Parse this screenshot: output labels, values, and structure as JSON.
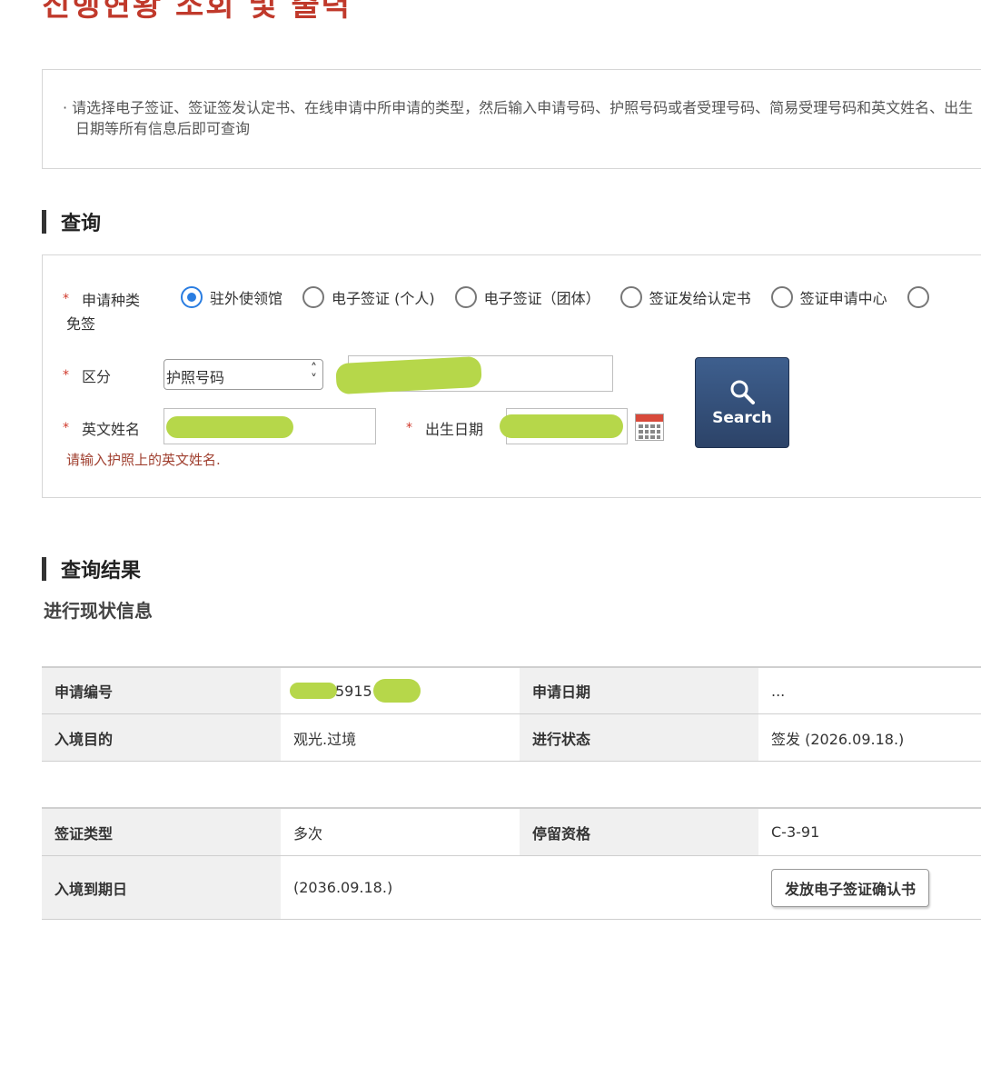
{
  "page": {
    "title": "진행현황 조회 및 출력"
  },
  "notice": {
    "text": "· 请选择电子签证、签证签发认定书、在线申请中所申请的类型，然后输入申请号码、护照号码或者受理号码、简易受理号码和英文姓名、出生日期等所有信息后即可查询"
  },
  "query_section": {
    "title": "查询"
  },
  "form": {
    "required_mark": "*",
    "app_type_label": "申请种类",
    "app_types": [
      {
        "label": "驻外使领馆",
        "selected": true
      },
      {
        "label": "电子签证 (个人)",
        "selected": false
      },
      {
        "label": "电子签证（团体）",
        "selected": false
      },
      {
        "label": "签证发给认定书",
        "selected": false
      },
      {
        "label": "签证申请中心",
        "selected": false
      },
      {
        "label": "免签",
        "selected": false
      }
    ],
    "category_label": "区分",
    "category_selected": "护照号码",
    "name_label": "英文姓名",
    "dob_label": "出生日期",
    "search_label": "Search",
    "hint": "请输入护照上的英文姓名."
  },
  "result_section": {
    "title": "查询结果",
    "subtitle": "进行现状信息"
  },
  "table1": {
    "rows": [
      {
        "k1": "申请编号",
        "v1": "5915",
        "k2": "申请日期",
        "v2": "..."
      },
      {
        "k1": "入境目的",
        "v1": "观光.过境",
        "k2": "进行状态",
        "v2": "签发 (2026.09.18.)"
      }
    ]
  },
  "table2": {
    "rows": [
      {
        "k1": "签证类型",
        "v1": "多次",
        "k2": "停留资格",
        "v2": "C-3-91"
      },
      {
        "k1": "入境到期日",
        "v1": "(2036.09.18.)",
        "k2": "",
        "v2_button": "发放电子签证确认书"
      }
    ]
  },
  "colors": {
    "accent": "#c0392b",
    "radio_selected": "#2a7de1",
    "redaction": "#b6d74a",
    "search_button": "#2c4368"
  }
}
